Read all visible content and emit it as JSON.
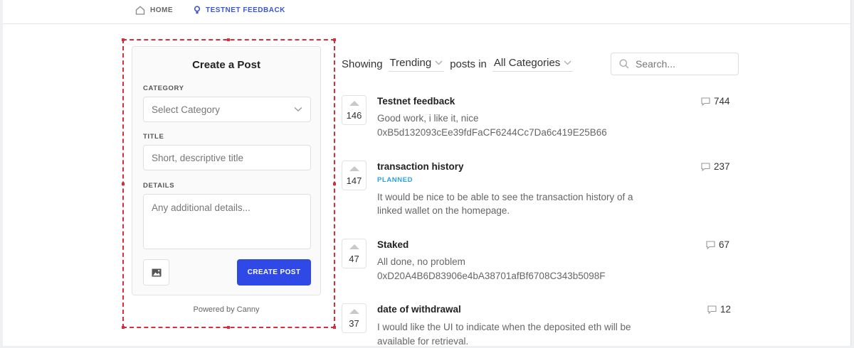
{
  "nav": {
    "home_label": "HOME",
    "feedback_label": "TESTNET FEEDBACK"
  },
  "create_post": {
    "title": "Create a Post",
    "category_label": "CATEGORY",
    "category_placeholder": "Select Category",
    "title_label": "TITLE",
    "title_placeholder": "Short, descriptive title",
    "details_label": "DETAILS",
    "details_placeholder": "Any additional details...",
    "create_button": "CREATE POST",
    "powered_by": "Powered by Canny"
  },
  "filters": {
    "showing_label": "Showing",
    "sort_value": "Trending",
    "posts_in_label": "posts in",
    "category_value": "All Categories",
    "search_placeholder": "Search..."
  },
  "posts": [
    {
      "votes": "146",
      "title": "Testnet feedback",
      "status": "",
      "line1": "Good work, i like it, nice",
      "line2": "0xB5d132093cEe39fdFaCF6244Cc7Da6c419E25B66",
      "comments": "744"
    },
    {
      "votes": "147",
      "title": "transaction history",
      "status": "PLANNED",
      "line1": "It would be nice to be able to see the transaction history of a",
      "line2": "linked wallet on the homepage.",
      "comments": "237"
    },
    {
      "votes": "47",
      "title": "Staked",
      "status": "",
      "line1": "All done, no problem",
      "line2": "0xD20A4B6D83906e4bA38701afBf6708C343b5098F",
      "comments": "67"
    },
    {
      "votes": "37",
      "title": "date of withdrawal",
      "status": "",
      "line1": "I would like the UI to indicate when the deposited eth will be",
      "line2": "available for retrieval.",
      "comments": "12"
    }
  ],
  "colors": {
    "accent": "#2f49e6",
    "planned": "#2aa0e6",
    "selection": "#d42f3a"
  }
}
